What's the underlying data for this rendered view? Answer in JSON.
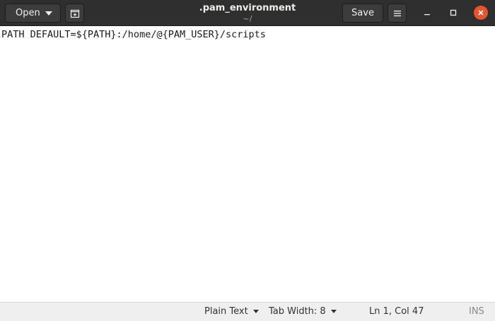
{
  "header": {
    "open_label": "Open",
    "title": ".pam_environment",
    "subtitle": "~/",
    "save_label": "Save",
    "icons": {
      "new_tab": "new-document-icon",
      "menu": "hamburger-menu-icon",
      "minimize": "minimize-icon",
      "maximize": "maximize-icon",
      "close": "close-icon"
    }
  },
  "editor": {
    "lines": [
      "PATH DEFAULT=${PATH}:/home/@{PAM_USER}/scripts"
    ]
  },
  "statusbar": {
    "language": "Plain Text",
    "tab_width": "Tab Width: 8",
    "position": "Ln 1, Col 47",
    "mode": "INS"
  },
  "colors": {
    "headerbar": "#2f2f2f",
    "close_button": "#e9542d",
    "statusbar": "#efefef"
  }
}
